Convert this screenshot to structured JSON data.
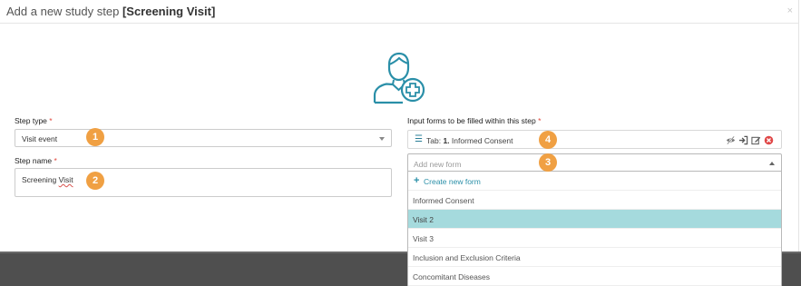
{
  "modal": {
    "title_prefix": "Add a new study step",
    "title_step": "[Screening Visit]",
    "close_glyph": "×"
  },
  "icons": {
    "hero": "add-user-icon",
    "close": "close-icon",
    "drag": "drag-handle-icon",
    "row_actions": [
      "eye-slash-icon",
      "sign-in-icon",
      "edit-icon",
      "remove-circle-icon"
    ],
    "caret": "chevron-down-icon"
  },
  "colors": {
    "accent": "#2a8fa8",
    "badge": "#f0a043",
    "required": "#e2483d",
    "selected_row": "#a5dadd",
    "remove": "#e04848"
  },
  "step_type": {
    "label": "Step type",
    "required_mark": "*",
    "value": "Visit event"
  },
  "step_name": {
    "label": "Step name",
    "required_mark": "*",
    "value_word1": "Screening",
    "value_word2": "Visit"
  },
  "input_forms": {
    "label": "Input forms to be filled within this step",
    "required_mark": "*",
    "items": [
      {
        "prefix": "Tab:",
        "number": "1.",
        "name": "Informed Consent"
      }
    ],
    "add_placeholder": "Add new form",
    "dropdown": {
      "create_label": "Create new form",
      "options": [
        "Informed Consent",
        "Visit 2",
        "Visit 3",
        "Inclusion and Exclusion Criteria",
        "Concomitant Diseases"
      ],
      "selected": "Visit 2"
    }
  },
  "badges": [
    "1",
    "2",
    "3",
    "4"
  ]
}
